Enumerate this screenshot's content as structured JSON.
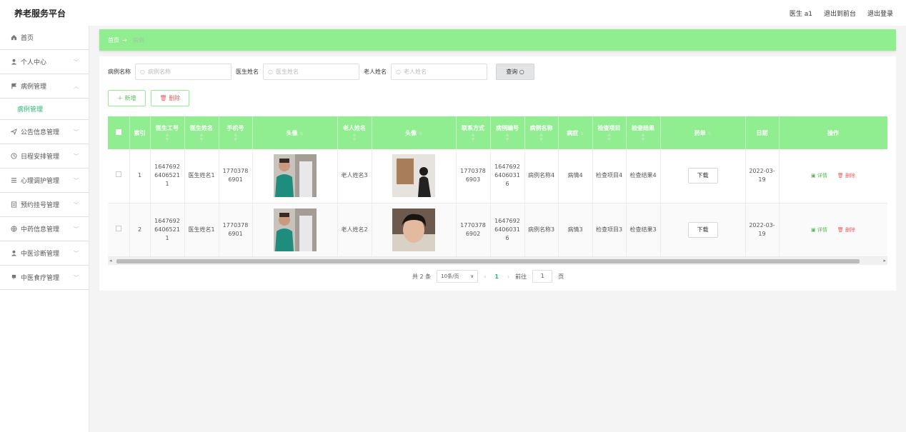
{
  "app_title": "养老服务平台",
  "header": {
    "user": "医生 a1",
    "back_label": "退出到前台",
    "logout_label": "退出登录"
  },
  "sidebar": {
    "items": [
      {
        "label": "首页",
        "icon": "home-icon"
      },
      {
        "label": "个人中心",
        "icon": "user-icon"
      },
      {
        "label": "病例管理",
        "icon": "flag-icon",
        "expanded": true,
        "sub": "病例管理"
      },
      {
        "label": "公告信息管理",
        "icon": "send-icon"
      },
      {
        "label": "日程安排管理",
        "icon": "clock-icon"
      },
      {
        "label": "心理调护管理",
        "icon": "list-icon"
      },
      {
        "label": "预约挂号管理",
        "icon": "document-icon"
      },
      {
        "label": "中药信息管理",
        "icon": "globe-icon"
      },
      {
        "label": "中医诊断管理",
        "icon": "user-icon"
      },
      {
        "label": "中医食疗管理",
        "icon": "bookmark-icon"
      }
    ]
  },
  "breadcrumb": {
    "home": "首页",
    "arrow": "→",
    "current": "病例"
  },
  "search": {
    "case_name_label": "病例名称",
    "case_name_placeholder": "病例名称",
    "doctor_name_label": "医生姓名",
    "doctor_name_placeholder": "医生姓名",
    "elder_name_label": "老人姓名",
    "elder_name_placeholder": "老人姓名",
    "query_label": "查询"
  },
  "actions": {
    "add_label": "新增",
    "delete_label": "删除"
  },
  "table": {
    "headers": [
      "索引",
      "医生工号",
      "医生姓名",
      "手机号",
      "头像",
      "老人姓名",
      "头像",
      "联系方式",
      "病例编号",
      "病例名称",
      "病症",
      "检查项目",
      "检查结果",
      "药单",
      "日期",
      "操作"
    ],
    "rows": [
      {
        "index": "1",
        "doctor_id": "16476926406521 1",
        "doctor_name": "医生姓名1",
        "phone": "17703786901",
        "elder_name": "老人姓名3",
        "contact": "17703786903",
        "case_no": "16476926406031 6",
        "case_name": "病例名称4",
        "symptom": "病情4",
        "check_item": "检查项目4",
        "check_result": "检查结果4",
        "download": "下载",
        "date": "2022-03-19",
        "detail": "详情",
        "delete": "删除"
      },
      {
        "index": "2",
        "doctor_id": "16476926406521 1",
        "doctor_name": "医生姓名1",
        "phone": "17703786901",
        "elder_name": "老人姓名2",
        "contact": "17703786902",
        "case_no": "16476926406031 6",
        "case_name": "病例名称3",
        "symptom": "病情3",
        "check_item": "检查项目3",
        "check_result": "检查结果3",
        "download": "下载",
        "date": "2022-03-19",
        "detail": "详情",
        "delete": "删除"
      }
    ]
  },
  "pagination": {
    "total": "共 2 条",
    "page_size": "10条/页",
    "current_page": "1",
    "goto_label": "前往",
    "goto_value": "1",
    "page_unit": "页"
  },
  "colors": {
    "accent": "#90ee90",
    "active_text": "#2bb673",
    "danger": "#e06060"
  }
}
